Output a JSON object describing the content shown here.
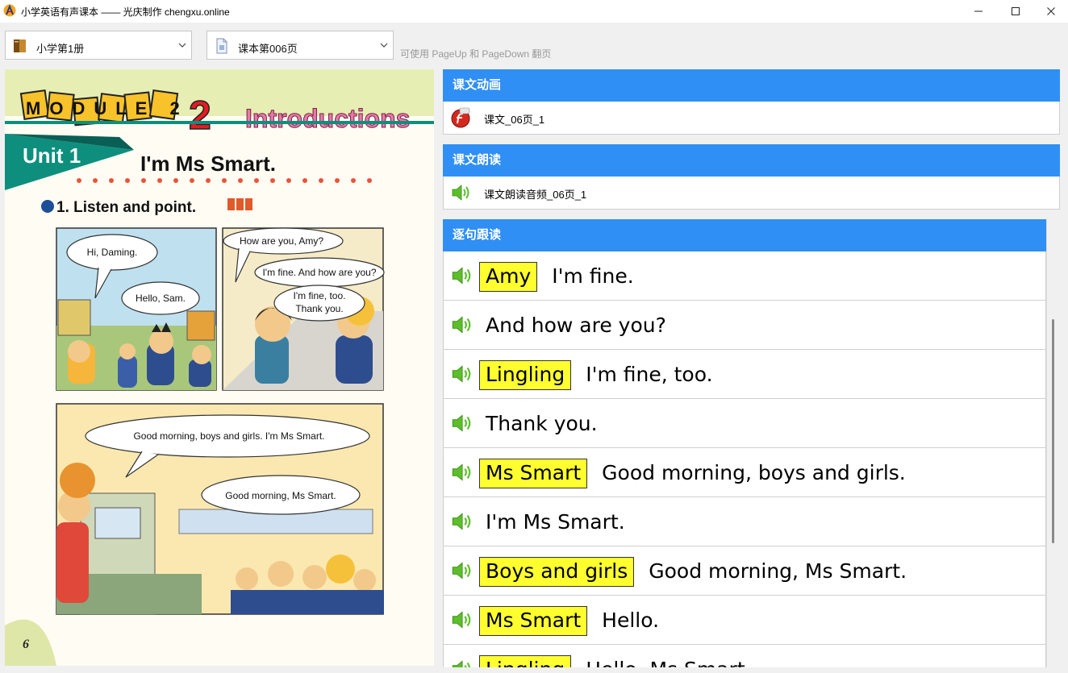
{
  "window": {
    "title": "小学英语有声课本 —— 光庆制作 chengxu.online",
    "min_icon": "minimize-icon",
    "max_icon": "maximize-icon",
    "close_icon": "close-icon"
  },
  "toolbar": {
    "book_select": {
      "value": "小学第1册",
      "icon": "book-icon"
    },
    "page_select": {
      "value": "课本第006页",
      "icon": "page-icon"
    },
    "hint": "可使用 PageUp 和 PageDown 翻页"
  },
  "textbook_page": {
    "module_title": "MODULE 2",
    "module_name": "Introductions",
    "unit_label": "Unit 1",
    "unit_title": "I'm Ms Smart.",
    "activity": "1. Listen and point.",
    "bubbles": {
      "p1_a": "Hi, Daming.",
      "p1_b": "Hello, Sam.",
      "p2_a": "How are you, Amy?",
      "p2_b": "I'm fine. And how are you?",
      "p2_c1": "I'm fine, too.",
      "p2_c2": "Thank you.",
      "p3_a": "Good morning, boys and girls. I'm Ms Smart.",
      "p3_b": "Good morning, Ms Smart."
    },
    "page_number": "6"
  },
  "sections": {
    "animation": {
      "header": "课文动画",
      "item": "课文_06页_1",
      "icon": "flash-swf-icon"
    },
    "reading": {
      "header": "课文朗读",
      "item": "课文朗读音频_06页_1",
      "icon": "speaker-icon"
    },
    "sentences": {
      "header": "逐句跟读",
      "items": [
        {
          "speaker": "Amy",
          "text": "I'm fine."
        },
        {
          "speaker": "",
          "text": "And how are you?"
        },
        {
          "speaker": "Lingling",
          "text": "I'm fine, too."
        },
        {
          "speaker": "",
          "text": "Thank you."
        },
        {
          "speaker": "Ms Smart",
          "text": "Good morning, boys and girls."
        },
        {
          "speaker": "",
          "text": "I'm Ms Smart."
        },
        {
          "speaker": "Boys and girls",
          "text": "Good morning, Ms Smart."
        },
        {
          "speaker": "Ms Smart",
          "text": "Hello."
        },
        {
          "speaker": "Lingling",
          "text": "Hello, Ms Smart."
        }
      ]
    }
  },
  "colors": {
    "accent": "#2f8ff5",
    "highlight": "#ffff30"
  }
}
